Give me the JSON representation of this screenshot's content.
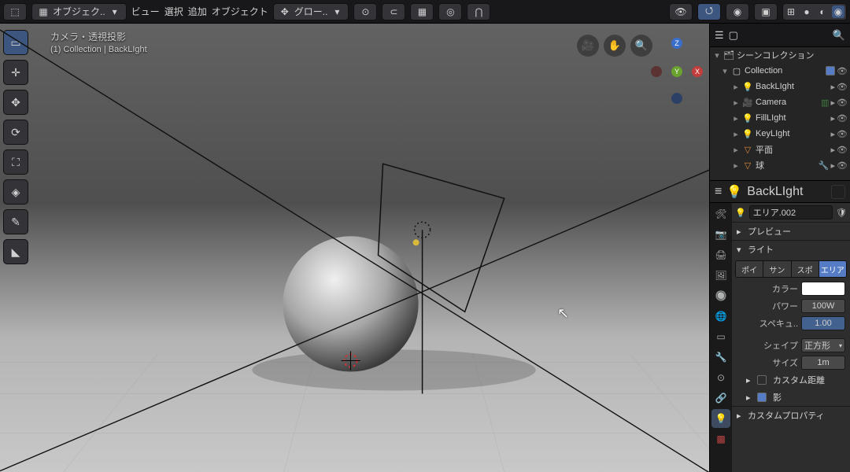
{
  "header": {
    "mode_label": "オブジェク..",
    "view": "ビュー",
    "select": "選択",
    "add": "追加",
    "object": "オブジェクト",
    "orient_label": "グロー.."
  },
  "overlay": {
    "line1": "カメラ・透視投影",
    "line2": "(1) Collection | BackLIght"
  },
  "gizmo": {
    "z": "Z",
    "y": "Y",
    "x": "X"
  },
  "outliner": {
    "title": "シーンコレクション",
    "rows": [
      {
        "depth": 1,
        "toggle": "▾",
        "icon": "▢",
        "label": "Collection",
        "chk": true,
        "eye": true
      },
      {
        "depth": 2,
        "toggle": "▸",
        "icon": "💡",
        "iconClass": "light-i",
        "label": "BackLIght",
        "eye": true
      },
      {
        "depth": 2,
        "toggle": "▸",
        "icon": "🎥",
        "iconClass": "cam-i",
        "label": "Camera",
        "eye": true,
        "extra": true
      },
      {
        "depth": 2,
        "toggle": "▸",
        "icon": "💡",
        "iconClass": "light-i",
        "label": "FillLIght",
        "eye": true
      },
      {
        "depth": 2,
        "toggle": "▸",
        "icon": "💡",
        "iconClass": "light-i",
        "label": "KeyLIght",
        "eye": true
      },
      {
        "depth": 2,
        "toggle": "▸",
        "icon": "▽",
        "iconClass": "mesh-i",
        "label": "平面",
        "eye": true
      },
      {
        "depth": 2,
        "toggle": "▸",
        "icon": "▽",
        "iconClass": "mesh-i",
        "label": "球",
        "eye": true,
        "wrench": true
      }
    ]
  },
  "props_header": {
    "name": "BackLIght"
  },
  "crumb": {
    "name": "エリア.002"
  },
  "panels": {
    "preview": "プレビュー",
    "light": "ライト",
    "types": {
      "point": "ポイ",
      "sun": "サン",
      "spot": "スポ",
      "area": "エリア"
    },
    "color_label": "カラー",
    "power_label": "パワー",
    "power_value": "100W",
    "specular_label": "スペキュ..",
    "specular_value": "1.00",
    "shape_label": "シェイプ",
    "shape_value": "正方形",
    "size_label": "サイズ",
    "size_value": "1m",
    "custom_dist": "カスタム距離",
    "shadow": "影",
    "custom_props": "カスタムプロパティ"
  }
}
